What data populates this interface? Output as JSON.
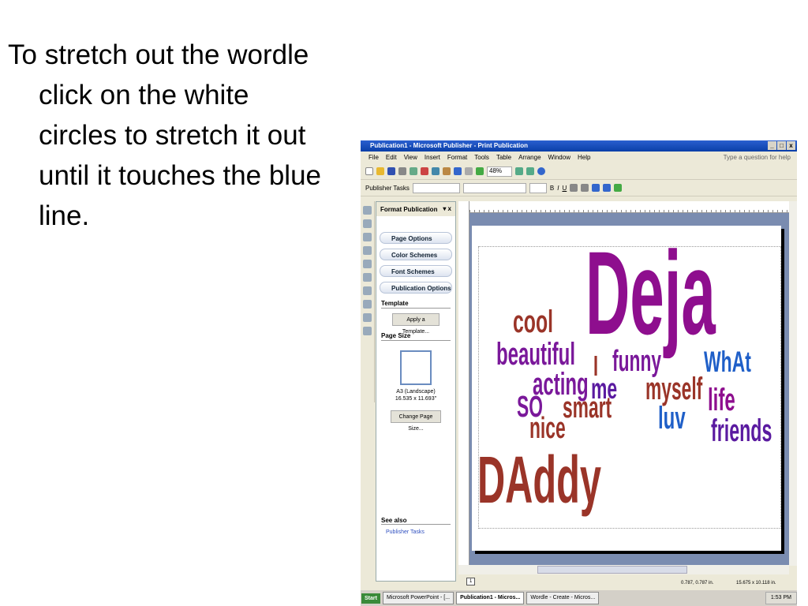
{
  "instruction": {
    "lines": [
      "To stretch out the wordle",
      "click on the white",
      "circles to stretch it out",
      "until it touches the blue",
      "line."
    ]
  },
  "window": {
    "title": "Publication1 - Microsoft Publisher - Print Publication",
    "menu": [
      "File",
      "Edit",
      "View",
      "Insert",
      "Format",
      "Tools",
      "Table",
      "Arrange",
      "Window",
      "Help"
    ],
    "help_placeholder": "Type a question for help",
    "zoom": "48%",
    "publisher_tasks": "Publisher Tasks"
  },
  "pane": {
    "title": "Format Publication",
    "sections": [
      "Page Options",
      "Color Schemes",
      "Font Schemes",
      "Publication Options"
    ],
    "template_label": "Template",
    "apply_template": "Apply a Template...",
    "page_size_label": "Page Size",
    "page_size_name": "A3 (Landscape)",
    "page_size_dims": "16.535 x 11.693\"",
    "change_page_size": "Change Page Size...",
    "see_also": "See also",
    "see_also_link": "Publisher Tasks"
  },
  "status": {
    "page": "1",
    "position": "0.787, 0.787 in.",
    "size": "15.675 x 10.118 in."
  },
  "taskbar": {
    "start": "Start",
    "tasks": [
      "Microsoft PowerPoint - [...",
      "Publication1 - Micros...",
      "Wordle - Create - Micros..."
    ],
    "clock": "1:53 PM"
  },
  "wordle": [
    {
      "text": "Deja",
      "color": "#8e0e8e"
    },
    {
      "text": "cool",
      "color": "#9a3428"
    },
    {
      "text": "beautiful",
      "color": "#7a189a"
    },
    {
      "text": "I",
      "color": "#9a3428"
    },
    {
      "text": "funny",
      "color": "#7a189a"
    },
    {
      "text": "WhAt",
      "color": "#1f5fc8"
    },
    {
      "text": "acting",
      "color": "#7a189a"
    },
    {
      "text": "me",
      "color": "#5a1aa0"
    },
    {
      "text": "myself",
      "color": "#9a3428"
    },
    {
      "text": "life",
      "color": "#8e0e8e"
    },
    {
      "text": "SO",
      "color": "#7a189a"
    },
    {
      "text": "smart",
      "color": "#9a3428"
    },
    {
      "text": "luv",
      "color": "#1f5fc8"
    },
    {
      "text": "nice",
      "color": "#9a3428"
    },
    {
      "text": "friends",
      "color": "#5a1aa0"
    },
    {
      "text": "DAddy",
      "color": "#9a3428"
    }
  ]
}
